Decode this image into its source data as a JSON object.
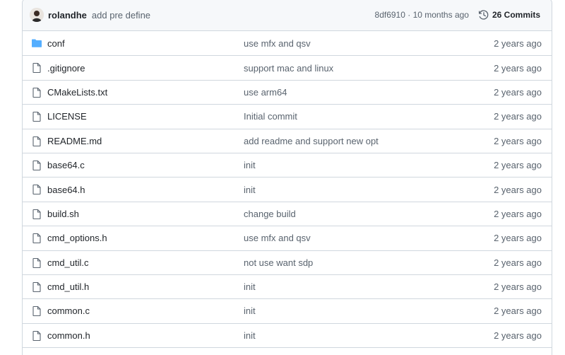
{
  "header": {
    "author": "rolandhe",
    "message": "add pre define",
    "sha_time": "8df6910 · 10 months ago",
    "commits_label": "26 Commits",
    "avatar_icon": "user-avatar",
    "history_icon": "history-clock-icon"
  },
  "files": [
    {
      "name": "conf",
      "type": "folder",
      "message": "use mfx and qsv",
      "age": "2 years ago"
    },
    {
      "name": ".gitignore",
      "type": "file",
      "message": "support mac and linux",
      "age": "2 years ago"
    },
    {
      "name": "CMakeLists.txt",
      "type": "file",
      "message": "use arm64",
      "age": "2 years ago"
    },
    {
      "name": "LICENSE",
      "type": "file",
      "message": "Initial commit",
      "age": "2 years ago"
    },
    {
      "name": "README.md",
      "type": "file",
      "message": "add readme and support new opt",
      "age": "2 years ago"
    },
    {
      "name": "base64.c",
      "type": "file",
      "message": "init",
      "age": "2 years ago"
    },
    {
      "name": "base64.h",
      "type": "file",
      "message": "init",
      "age": "2 years ago"
    },
    {
      "name": "build.sh",
      "type": "file",
      "message": "change build",
      "age": "2 years ago"
    },
    {
      "name": "cmd_options.h",
      "type": "file",
      "message": "use mfx and qsv",
      "age": "2 years ago"
    },
    {
      "name": "cmd_util.c",
      "type": "file",
      "message": "not use want sdp",
      "age": "2 years ago"
    },
    {
      "name": "cmd_util.h",
      "type": "file",
      "message": "init",
      "age": "2 years ago"
    },
    {
      "name": "common.c",
      "type": "file",
      "message": "init",
      "age": "2 years ago"
    },
    {
      "name": "common.h",
      "type": "file",
      "message": "init",
      "age": "2 years ago"
    },
    {
      "name": "",
      "type": "file",
      "message": "",
      "age": ""
    }
  ],
  "colors": {
    "folder": "#54aeff",
    "file_icon": "#59636e",
    "border": "#d0d7de",
    "header_bg": "#f6f8fa"
  }
}
